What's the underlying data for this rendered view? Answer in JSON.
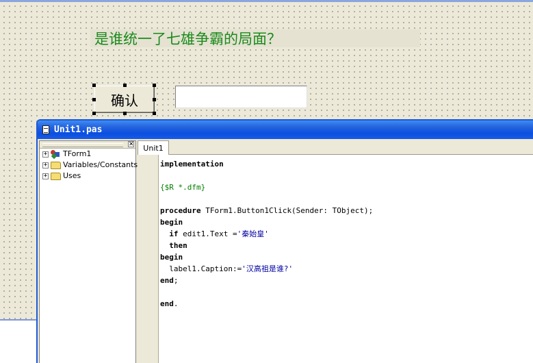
{
  "form": {
    "label_caption": "是谁统一了七雄争霸的局面？",
    "button_caption": "确认",
    "edit_text": ""
  },
  "editor": {
    "window_title": "Unit1.pas",
    "explorer": {
      "close_glyph": "✕",
      "items": [
        {
          "label": "TForm1",
          "icon": "form-icon",
          "expander": "+"
        },
        {
          "label": "Variables/Constants",
          "icon": "folder-icon",
          "expander": "+"
        },
        {
          "label": "Uses",
          "icon": "folder-icon",
          "expander": "+"
        }
      ]
    },
    "tabs": [
      {
        "label": "Unit1"
      }
    ],
    "code": {
      "l1_kw": "implementation",
      "l3_dir": "{$R *.dfm}",
      "l5_kw": "procedure",
      "l5_rest": " TForm1.Button1Click(Sender: TObject);",
      "l6_kw": "begin",
      "l7_indent": "  ",
      "l7_kw": "if",
      "l7_rest": " edit1.Text =",
      "l7_str": "'秦始皇'",
      "l8_indent": "  ",
      "l8_kw": "then",
      "l9_kw": "begin",
      "l10_rest": "  label1.Caption:=",
      "l10_str": "'汉高祖是谁?'",
      "l11_kw": "end",
      "l11_rest": ";",
      "l13_kw": "end",
      "l13_rest": "."
    }
  },
  "colors": {
    "label_text": "#1a8a1a",
    "titlebar": "#1b58d6",
    "string_literal": "#0000a0",
    "directive": "#008000"
  }
}
